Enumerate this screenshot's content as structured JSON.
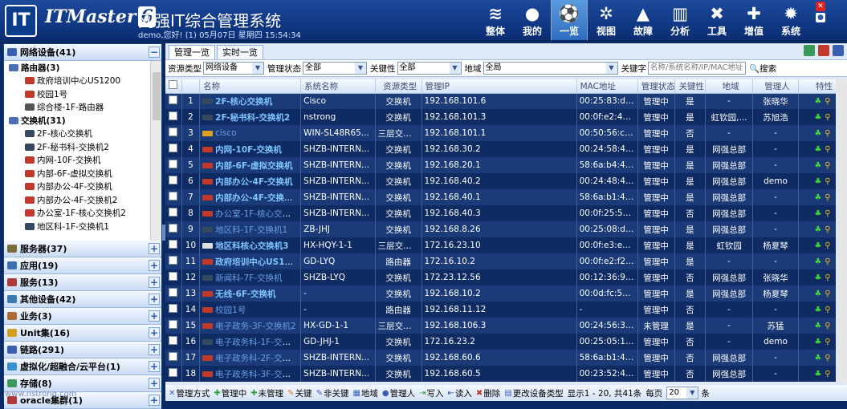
{
  "header": {
    "logo_text": "IT",
    "brand": "ITMaster",
    "brand_version": "6",
    "title": "网强IT综合管理系统",
    "greeting": "demo,您好! (1) 05月07日 星期四 15:54:34",
    "nav": [
      {
        "label": "整体",
        "icon": "layers-icon",
        "glyph": "≋"
      },
      {
        "label": "我的",
        "icon": "user-icon",
        "glyph": "●"
      },
      {
        "label": "一览",
        "icon": "soccer-ball-icon",
        "glyph": "⚽"
      },
      {
        "label": "视图",
        "icon": "network-icon",
        "glyph": "✲"
      },
      {
        "label": "故障",
        "icon": "warning-icon",
        "glyph": "▲"
      },
      {
        "label": "分析",
        "icon": "chart-icon",
        "glyph": "▥"
      },
      {
        "label": "工具",
        "icon": "tools-icon",
        "glyph": "✖"
      },
      {
        "label": "增值",
        "icon": "plus-icon",
        "glyph": "✚"
      },
      {
        "label": "系统",
        "icon": "gear-icon",
        "glyph": "✹"
      }
    ],
    "active_nav": "一览"
  },
  "sidebar": {
    "top_section": {
      "label": "网络设备(41)",
      "toggle": "−"
    },
    "tree": [
      {
        "type": "group",
        "label": "路由器(3)",
        "color": "#4a6fb5"
      },
      {
        "type": "leaf",
        "label": "政府培训中心US1200",
        "color": "#c0392b"
      },
      {
        "type": "leaf",
        "label": "校园1号",
        "color": "#c0392b"
      },
      {
        "type": "leaf",
        "label": "综合楼-1F-路由器",
        "color": "#555555"
      },
      {
        "type": "group",
        "label": "交换机(31)",
        "color": "#4a6fb5"
      },
      {
        "type": "leaf",
        "label": "2F-核心交换机",
        "color": "#34495e"
      },
      {
        "type": "leaf",
        "label": "2F-秘书科-交换机2",
        "color": "#34495e"
      },
      {
        "type": "leaf",
        "label": "内网-10F-交换机",
        "color": "#c0392b"
      },
      {
        "type": "leaf",
        "label": "内部-6F-虚拟交换机",
        "color": "#c0392b"
      },
      {
        "type": "leaf",
        "label": "内部办公-4F-交换机",
        "color": "#c0392b"
      },
      {
        "type": "leaf",
        "label": "内部办公-4F-交换机2",
        "color": "#c0392b"
      },
      {
        "type": "leaf",
        "label": "办公室-1F-核心交换机2",
        "color": "#c0392b"
      },
      {
        "type": "leaf",
        "label": "地区科-1F-交换机1",
        "color": "#34495e"
      }
    ],
    "sections": [
      {
        "label": "服务器(37)",
        "color": "#7b6a3a"
      },
      {
        "label": "应用(19)",
        "color": "#3a6fb0"
      },
      {
        "label": "服务(13)",
        "color": "#b03a3a"
      },
      {
        "label": "其他设备(42)",
        "color": "#3a7ab0"
      },
      {
        "label": "业务(3)",
        "color": "#b06a3a"
      },
      {
        "label": "Unit集(16)",
        "color": "#d4a020"
      },
      {
        "label": "链路(291)",
        "color": "#3a5fb0"
      },
      {
        "label": "虚拟化/超融合/云平台(1)",
        "color": "#3a8fd0"
      },
      {
        "label": "存储(8)",
        "color": "#3a9a5a"
      },
      {
        "label": "oracle集群(1)",
        "color": "#b03a3a"
      }
    ],
    "section_toggle": "+"
  },
  "tabs": [
    "管理一览",
    "实时一览"
  ],
  "active_tab": "管理一览",
  "filter": {
    "resource_type_label": "资源类型",
    "resource_type_value": "网络设备",
    "mgmt_status_label": "管理状态",
    "mgmt_status_value": "全部",
    "key_label": "关键性",
    "key_value": "全部",
    "location_label": "地域",
    "location_value": "全局",
    "keyword_label": "关键字",
    "keyword_placeholder": "名称/系统名称/IP/MAC地址",
    "search_label": "搜索"
  },
  "table": {
    "columns": [
      "",
      "",
      "名称",
      "系统名称",
      "资源类型",
      "管理IP",
      "MAC地址",
      "管理状态",
      "关键性",
      "地域",
      "管理人",
      "特性"
    ],
    "rows": [
      {
        "no": "1",
        "name": "2F-核心交换机",
        "bold": true,
        "icon": "#34495e",
        "sys": "Cisco",
        "type": "交换机",
        "ip": "192.168.101.6",
        "mac": "00:25:83:d1:...",
        "status": "管理中",
        "key": "是",
        "loc": "-",
        "owner": "张晓华"
      },
      {
        "no": "2",
        "name": "2F-秘书科-交换机2",
        "bold": true,
        "icon": "#34495e",
        "sys": "nstrong",
        "type": "交换机",
        "ip": "192.168.101.3",
        "mac": "00:0f:e2:4b:...",
        "status": "管理中",
        "key": "是",
        "loc": "虹钦园,...",
        "owner": "苏旭浩"
      },
      {
        "no": "3",
        "name": "cisco",
        "bold": false,
        "icon": "#e0a020",
        "sys": "WIN-SL48R65...",
        "type": "三层交换机",
        "ip": "192.168.101.1",
        "mac": "00:50:56:c0:...",
        "status": "管理中",
        "key": "否",
        "loc": "-",
        "owner": "-"
      },
      {
        "no": "4",
        "name": "内网-10F-交换机",
        "bold": true,
        "icon": "#c0392b",
        "sys": "SHZB-INTERN...",
        "type": "交换机",
        "ip": "192.168.30.2",
        "mac": "00:24:58:47:...",
        "status": "管理中",
        "key": "是",
        "loc": "网强总部",
        "owner": "-"
      },
      {
        "no": "5",
        "name": "内部-6F-虚拟交换机",
        "bold": true,
        "icon": "#c0392b",
        "sys": "SHZB-INTERN...",
        "type": "交换机",
        "ip": "192.168.20.1",
        "mac": "58:6a:b4:4f:ff...",
        "status": "管理中",
        "key": "是",
        "loc": "网强总部",
        "owner": "-"
      },
      {
        "no": "6",
        "name": "内部办公-4F-交换机",
        "bold": true,
        "icon": "#c0392b",
        "sys": "SHZB-INTERN...",
        "type": "交换机",
        "ip": "192.168.40.2",
        "mac": "00:24:48:43:...",
        "status": "管理中",
        "key": "是",
        "loc": "网强总部",
        "owner": "demo"
      },
      {
        "no": "7",
        "name": "内部办公-4F-交换机2",
        "bold": true,
        "icon": "#c0392b",
        "sys": "SHZB-INTERN...",
        "type": "交换机",
        "ip": "192.168.40.1",
        "mac": "58:6a:b1:4c:...",
        "status": "管理中",
        "key": "是",
        "loc": "网强总部",
        "owner": "-"
      },
      {
        "no": "8",
        "name": "办公室-1F-核心交换...",
        "bold": false,
        "icon": "#c0392b",
        "sys": "SHZB-INTERN...",
        "type": "交换机",
        "ip": "192.168.40.3",
        "mac": "00:0f:25:52:3...",
        "status": "管理中",
        "key": "否",
        "loc": "网强总部",
        "owner": "-"
      },
      {
        "no": "9",
        "name": "地区科-1F-交换机1",
        "bold": false,
        "icon": "#34495e",
        "sys": "ZB-JHJ",
        "type": "交换机",
        "ip": "192.168.8.26",
        "mac": "00:25:08:d3:...",
        "status": "管理中",
        "key": "是",
        "loc": "网强总部",
        "owner": "-"
      },
      {
        "no": "10",
        "name": "地区科核心交换机3",
        "bold": true,
        "icon": "#e0e0e0",
        "sys": "HX-HQY-1-1",
        "type": "三层交换机",
        "ip": "172.16.23.10",
        "mac": "00:0f:e3:ee:6...",
        "status": "管理中",
        "key": "是",
        "loc": "虹钦园",
        "owner": "杨夏琴"
      },
      {
        "no": "11",
        "name": "政府培训中心US1200",
        "bold": true,
        "icon": "#c0392b",
        "sys": "GD-LYQ",
        "type": "路由器",
        "ip": "172.16.10.2",
        "mac": "00:0f:e2:f2:a...",
        "status": "管理中",
        "key": "是",
        "loc": "-",
        "owner": "-"
      },
      {
        "no": "12",
        "name": "新闻科-7F-交换机",
        "bold": false,
        "icon": "#34495e",
        "sys": "SHZB-LYQ",
        "type": "交换机",
        "ip": "172.23.12.56",
        "mac": "00:12:36:9e:...",
        "status": "管理中",
        "key": "否",
        "loc": "网强总部",
        "owner": "张晓华"
      },
      {
        "no": "13",
        "name": "无线-6F-交换机",
        "bold": true,
        "icon": "#c0392b",
        "sys": "-",
        "type": "交换机",
        "ip": "192.168.10.2",
        "mac": "00:0d:fc:59:ff...",
        "status": "管理中",
        "key": "是",
        "loc": "网强总部",
        "owner": "杨夏琴"
      },
      {
        "no": "14",
        "name": "校园1号",
        "bold": false,
        "icon": "#c0392b",
        "sys": "-",
        "type": "路由器",
        "ip": "192.168.11.12",
        "mac": "-",
        "status": "管理中",
        "key": "否",
        "loc": "-",
        "owner": "-"
      },
      {
        "no": "15",
        "name": "电子政务-3F-交换机2",
        "bold": false,
        "icon": "#c0392b",
        "sys": "HX-GD-1-1",
        "type": "三层交换机",
        "ip": "192.168.106.3",
        "mac": "00:24:56:30:...",
        "status": "未管理",
        "key": "是",
        "loc": "-",
        "owner": "苏猛"
      },
      {
        "no": "16",
        "name": "电子政务科-1F-交换...",
        "bold": false,
        "icon": "#34495e",
        "sys": "GD-JHJ-1",
        "type": "交换机",
        "ip": "172.16.23.2",
        "mac": "00:25:05:10:...",
        "status": "管理中",
        "key": "否",
        "loc": "-",
        "owner": "demo"
      },
      {
        "no": "17",
        "name": "电子政务科-2F-交换...",
        "bold": false,
        "icon": "#c0392b",
        "sys": "SHZB-INTERN...",
        "type": "交换机",
        "ip": "192.168.60.6",
        "mac": "58:6a:b1:4f:ff...",
        "status": "管理中",
        "key": "否",
        "loc": "网强总部",
        "owner": "-"
      },
      {
        "no": "18",
        "name": "电子政务科-3F-交换...",
        "bold": false,
        "icon": "#c0392b",
        "sys": "SHZB-INTERN...",
        "type": "交换机",
        "ip": "192.168.60.5",
        "mac": "00:23:52:45:...",
        "status": "管理中",
        "key": "否",
        "loc": "网强总部",
        "owner": "-"
      }
    ]
  },
  "bottom": {
    "actions": [
      {
        "label": "管理方式",
        "glyph": "✕",
        "color": "#3a5fb0"
      },
      {
        "label": "管理中",
        "glyph": "✚",
        "color": "#2e9e3e"
      },
      {
        "label": "未管理",
        "glyph": "✚",
        "color": "#2e9e3e"
      },
      {
        "label": "关键",
        "glyph": "✎",
        "color": "#d08020"
      },
      {
        "label": "非关键",
        "glyph": "✎",
        "color": "#3a5fb0"
      },
      {
        "label": "地域",
        "glyph": "▦",
        "color": "#3a5fb0"
      },
      {
        "label": "管理人",
        "glyph": "●",
        "color": "#3a5fb0"
      },
      {
        "label": "写入",
        "glyph": "⇥",
        "color": "#2e9e3e"
      },
      {
        "label": "读入",
        "glyph": "⇤",
        "color": "#3a5fb0"
      },
      {
        "label": "删除",
        "glyph": "✖",
        "color": "#c0392b"
      },
      {
        "label": "更改设备类型",
        "glyph": "▤",
        "color": "#3a5fb0"
      }
    ],
    "range_text": "显示1 - 20, 共41条",
    "per_page_label": "每页",
    "per_page_value": "20",
    "per_page_unit": "条"
  },
  "watermark": "www.nstrong.com"
}
